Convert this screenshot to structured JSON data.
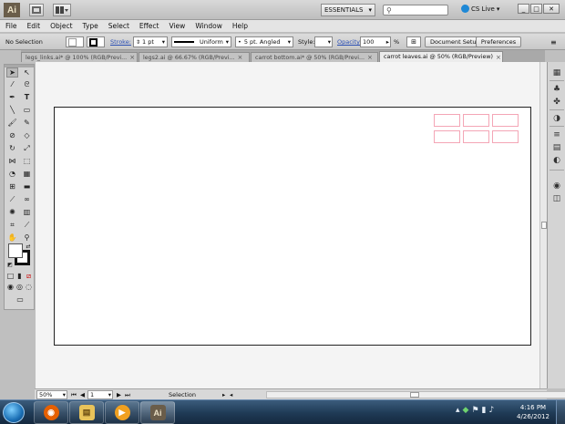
{
  "app": {
    "logo": "Ai",
    "workspace": "ESSENTIALS",
    "search_placeholder": "",
    "cs_live": "CS Live",
    "window_controls": [
      "_",
      "□",
      "✕"
    ]
  },
  "menu": [
    "File",
    "Edit",
    "Object",
    "Type",
    "Select",
    "Effect",
    "View",
    "Window",
    "Help"
  ],
  "control_bar": {
    "selection_label": "No Selection",
    "stroke_label": "Stroke:",
    "stroke_weight": "1 pt",
    "stroke_profile": "Uniform",
    "brush": "5 pt. Angled",
    "style_label": "Style:",
    "opacity_label": "Opacity:",
    "opacity_value": "100",
    "opacity_unit": "%",
    "document_setup": "Document Setup",
    "preferences": "Preferences"
  },
  "tabs": [
    {
      "label": "legs_links.ai* @ 100% (RGB/Previ...",
      "active": false
    },
    {
      "label": "legs2.ai @ 66.67% (RGB/Previ...",
      "active": false
    },
    {
      "label": "carrot bottom.ai* @ 50% (RGB/Previ...",
      "active": false
    },
    {
      "label": "carrot leaves.ai @ 50% (RGB/Preview)",
      "active": true
    }
  ],
  "status_bar": {
    "zoom": "50%",
    "artboard_number": "1",
    "tool": "Selection"
  },
  "taskbar": {
    "apps": [
      {
        "name": "Firefox",
        "glyph": "◉",
        "color": "#e66000",
        "active": false
      },
      {
        "name": "Windows Explorer",
        "glyph": "▤",
        "color": "#e8c35a",
        "active": false
      },
      {
        "name": "Windows Media Player",
        "glyph": "▶",
        "color": "#f0a020",
        "active": false
      },
      {
        "name": "Adobe Illustrator",
        "glyph": "Ai",
        "color": "#6a5d4a",
        "active": true
      }
    ],
    "time": "4:16 PM",
    "date": "4/26/2012"
  },
  "colors": {
    "accent_link": "#2b4fb5",
    "guide_pink": "#f4a6b6",
    "illustrator_brand": "#6a5d4a"
  }
}
